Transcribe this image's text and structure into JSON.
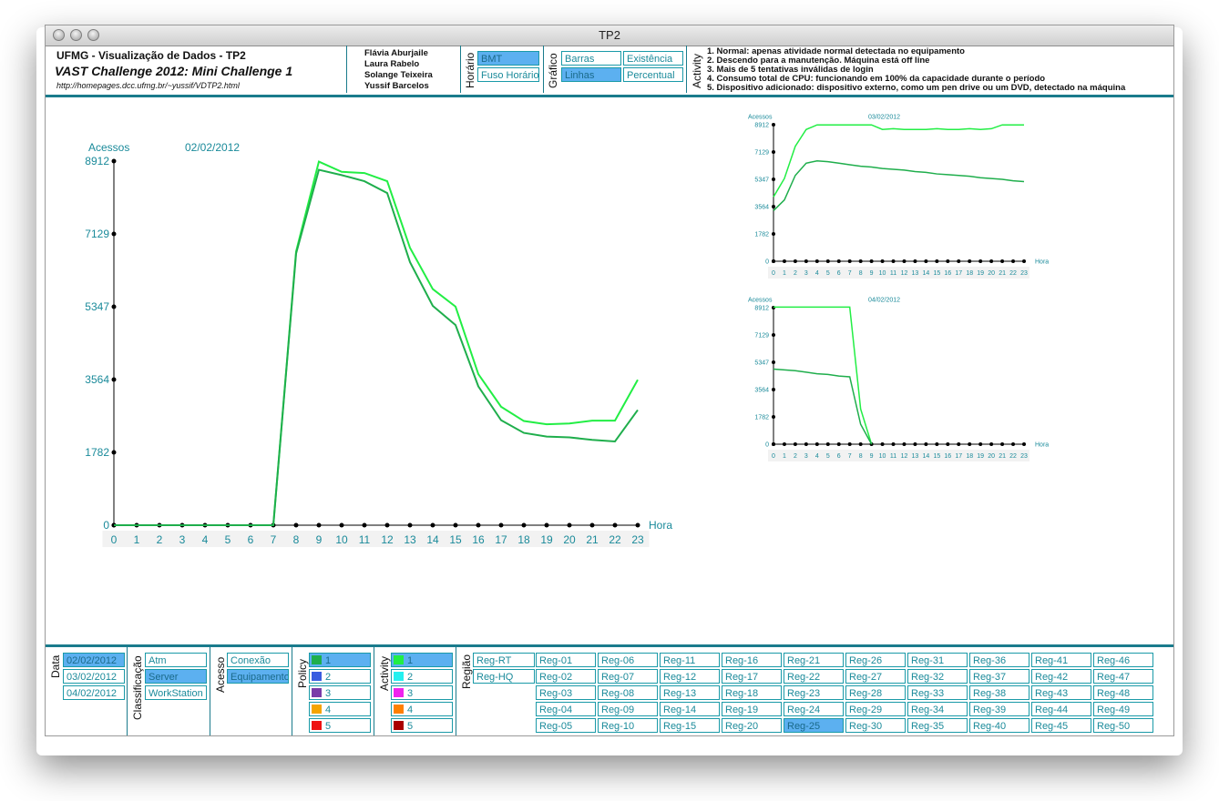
{
  "window": {
    "title": "TP2"
  },
  "header": {
    "course": "UFMG - Visualização de Dados - TP2",
    "subtitle": "VAST Challenge 2012: Mini Challenge 1",
    "url": "http://homepages.dcc.ufmg.br/~yussif/VDTP2.html",
    "authors": [
      "Flávia Aburjaile",
      "Laura Rabelo",
      "Solange Teixeira",
      "Yussif Barcelos"
    ],
    "horario": {
      "label": "Horário",
      "options": [
        {
          "label": "BMT",
          "selected": true
        },
        {
          "label": "Fuso Horário",
          "selected": false
        }
      ]
    },
    "grafico": {
      "label": "Gráfico",
      "options": [
        {
          "label": "Barras",
          "selected": false
        },
        {
          "label": "Existência",
          "selected": false
        },
        {
          "label": "Linhas",
          "selected": true
        },
        {
          "label": "Percentual",
          "selected": false
        }
      ]
    },
    "activity": {
      "label": "Activity",
      "items": [
        "1. Normal: apenas atividade normal detectada no equipamento",
        "2. Descendo para a manutenção. Máquina está off line",
        "3. Mais de 5 tentativas inválidas de login",
        "4. Consumo total de CPU: funcionando em 100% da capacidade durante o período",
        "5. Dispositivo adicionado: dispositivo externo, como um pen drive ou um DVD, detectado na máquina"
      ]
    }
  },
  "chart_data": [
    {
      "type": "line",
      "title": "02/02/2012",
      "ylabel": "Acessos",
      "xlabel": "Hora",
      "x": [
        0,
        1,
        2,
        3,
        4,
        5,
        6,
        7,
        8,
        9,
        10,
        11,
        12,
        13,
        14,
        15,
        16,
        17,
        18,
        19,
        20,
        21,
        22,
        23
      ],
      "yticks": [
        0,
        1782,
        3564,
        5347,
        7129,
        8912
      ],
      "ylim": [
        0,
        8912
      ],
      "series": [
        {
          "color": "#22ee44",
          "values": [
            0,
            0,
            0,
            0,
            0,
            0,
            0,
            0,
            6700,
            8900,
            8650,
            8620,
            8420,
            6790,
            5780,
            5350,
            3700,
            2900,
            2550,
            2470,
            2490,
            2560,
            2560,
            3560
          ]
        },
        {
          "color": "#1fae4c",
          "values": [
            0,
            0,
            0,
            0,
            0,
            0,
            0,
            0,
            6650,
            8700,
            8570,
            8420,
            8130,
            6440,
            5370,
            4900,
            3400,
            2570,
            2260,
            2170,
            2150,
            2090,
            2050,
            2820
          ]
        }
      ]
    },
    {
      "type": "line",
      "title": "03/02/2012",
      "ylabel": "Acessos",
      "xlabel": "Hora",
      "x": [
        0,
        1,
        2,
        3,
        4,
        5,
        6,
        7,
        8,
        9,
        10,
        11,
        12,
        13,
        14,
        15,
        16,
        17,
        18,
        19,
        20,
        21,
        22,
        23
      ],
      "yticks": [
        0,
        1782,
        3564,
        5347,
        7129,
        8912
      ],
      "ylim": [
        0,
        8912
      ],
      "series": [
        {
          "color": "#22ee44",
          "values": [
            4200,
            5400,
            7500,
            8600,
            8900,
            8900,
            8900,
            8900,
            8900,
            8900,
            8600,
            8650,
            8600,
            8600,
            8600,
            8650,
            8600,
            8600,
            8650,
            8600,
            8650,
            8900,
            8900,
            8900
          ]
        },
        {
          "color": "#1fae4c",
          "values": [
            3300,
            4000,
            5600,
            6400,
            6550,
            6500,
            6400,
            6300,
            6200,
            6150,
            6050,
            6000,
            5950,
            5850,
            5800,
            5700,
            5650,
            5600,
            5550,
            5450,
            5400,
            5350,
            5250,
            5200
          ]
        }
      ]
    },
    {
      "type": "line",
      "title": "04/02/2012",
      "ylabel": "Acessos",
      "xlabel": "Hora",
      "x": [
        0,
        1,
        2,
        3,
        4,
        5,
        6,
        7,
        8,
        9,
        10,
        11,
        12,
        13,
        14,
        15,
        16,
        17,
        18,
        19,
        20,
        21,
        22,
        23
      ],
      "yticks": [
        0,
        1782,
        3564,
        5347,
        7129,
        8912
      ],
      "ylim": [
        0,
        8912
      ],
      "series": [
        {
          "color": "#22ee44",
          "values": [
            8950,
            8950,
            8950,
            8950,
            8950,
            8950,
            8950,
            8950,
            2300,
            0
          ]
        },
        {
          "color": "#1fae4c",
          "values": [
            4900,
            4850,
            4800,
            4700,
            4600,
            4550,
            4450,
            4400,
            1300,
            0
          ]
        }
      ]
    }
  ],
  "filters": {
    "data": {
      "label": "Data",
      "options": [
        {
          "label": "02/02/2012",
          "selected": true
        },
        {
          "label": "03/02/2012",
          "selected": false
        },
        {
          "label": "04/02/2012",
          "selected": false
        }
      ]
    },
    "classificacao": {
      "label": "Classificação",
      "options": [
        {
          "label": "Atm",
          "selected": false
        },
        {
          "label": "Server",
          "selected": true
        },
        {
          "label": "WorkStation",
          "selected": false
        }
      ]
    },
    "acesso": {
      "label": "Acesso",
      "options": [
        {
          "label": "Conexão",
          "selected": false
        },
        {
          "label": "Equipamento",
          "selected": true
        }
      ]
    },
    "policy": {
      "label": "Policy",
      "options": [
        {
          "label": "1",
          "color": "#1fae4c",
          "selected": true
        },
        {
          "label": "2",
          "color": "#3a5de0",
          "selected": false
        },
        {
          "label": "3",
          "color": "#7a3aa8",
          "selected": false
        },
        {
          "label": "4",
          "color": "#f4a400",
          "selected": false
        },
        {
          "label": "5",
          "color": "#ee1111",
          "selected": false
        }
      ]
    },
    "activity": {
      "label": "Activity",
      "options": [
        {
          "label": "1",
          "color": "#22ee44",
          "selected": true
        },
        {
          "label": "2",
          "color": "#22f0f0",
          "selected": false
        },
        {
          "label": "3",
          "color": "#ee22ee",
          "selected": false
        },
        {
          "label": "4",
          "color": "#ff8000",
          "selected": false
        },
        {
          "label": "5",
          "color": "#aa0000",
          "selected": false
        }
      ]
    },
    "regiao": {
      "label": "Região",
      "special": [
        {
          "label": "Reg-RT",
          "selected": false
        },
        {
          "label": "Reg-HQ",
          "selected": false
        }
      ],
      "options": [
        "Reg-01",
        "Reg-02",
        "Reg-03",
        "Reg-04",
        "Reg-05",
        "Reg-06",
        "Reg-07",
        "Reg-08",
        "Reg-09",
        "Reg-10",
        "Reg-11",
        "Reg-12",
        "Reg-13",
        "Reg-14",
        "Reg-15",
        "Reg-16",
        "Reg-17",
        "Reg-18",
        "Reg-19",
        "Reg-20",
        "Reg-21",
        "Reg-22",
        "Reg-23",
        "Reg-24",
        "Reg-25",
        "Reg-26",
        "Reg-27",
        "Reg-28",
        "Reg-29",
        "Reg-30",
        "Reg-31",
        "Reg-32",
        "Reg-33",
        "Reg-34",
        "Reg-35",
        "Reg-36",
        "Reg-37",
        "Reg-38",
        "Reg-39",
        "Reg-40",
        "Reg-41",
        "Reg-42",
        "Reg-43",
        "Reg-44",
        "Reg-45",
        "Reg-46",
        "Reg-47",
        "Reg-48",
        "Reg-49",
        "Reg-50"
      ],
      "selected": "Reg-25"
    }
  }
}
